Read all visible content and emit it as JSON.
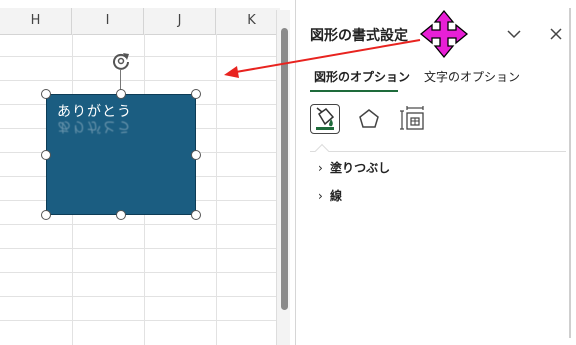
{
  "sheet": {
    "columns": [
      "H",
      "I",
      "J",
      "K"
    ],
    "shape_text": "ありがとう"
  },
  "pane": {
    "title": "図形の書式設定",
    "tabs": [
      {
        "label": "図形のオプション",
        "active": true
      },
      {
        "label": "文字のオプション",
        "active": false
      }
    ],
    "sections": [
      {
        "label": "塗りつぶし"
      },
      {
        "label": "線"
      }
    ]
  },
  "icons": {
    "collapse": "chevron-down-icon",
    "close": "close-icon",
    "fill_line": "paint-bucket-icon",
    "effects": "pentagon-icon",
    "size_properties": "size-properties-icon",
    "move_cursor": "move-arrows-icon",
    "rotate": "rotate-icon"
  },
  "colors": {
    "shape_fill": "#1b5d81",
    "tab_underline": "#1e6b3b",
    "arrow": "#e8231f",
    "move_cursor": "#e81fd6"
  }
}
